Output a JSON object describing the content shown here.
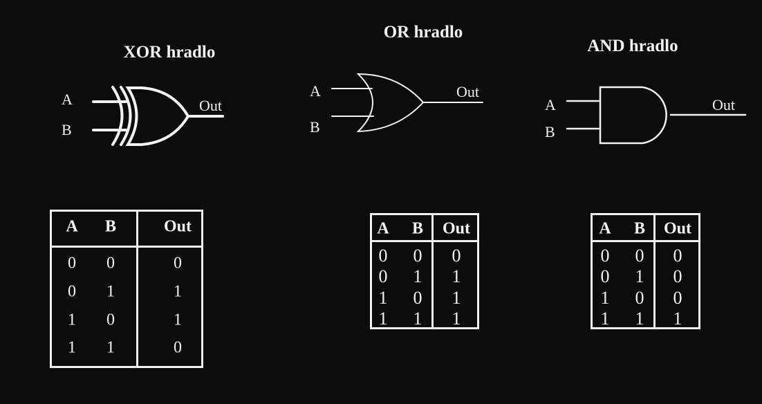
{
  "xor": {
    "title": "XOR hradlo",
    "input_a": "A",
    "input_b": "B",
    "output": "Out",
    "table": {
      "headers": [
        "A",
        "B",
        "Out"
      ],
      "rows": [
        [
          "0",
          "0",
          "0"
        ],
        [
          "0",
          "1",
          "1"
        ],
        [
          "1",
          "0",
          "1"
        ],
        [
          "1",
          "1",
          "0"
        ]
      ]
    }
  },
  "or": {
    "title": "OR hradlo",
    "input_a": "A",
    "input_b": "B",
    "output": "Out",
    "table": {
      "headers": [
        "A",
        "B",
        "Out"
      ],
      "rows": [
        [
          "0",
          "0",
          "0"
        ],
        [
          "0",
          "1",
          "1"
        ],
        [
          "1",
          "0",
          "1"
        ],
        [
          "1",
          "1",
          "1"
        ]
      ]
    }
  },
  "and": {
    "title": "AND hradlo",
    "input_a": "A",
    "input_b": "B",
    "output": "Out",
    "table": {
      "headers": [
        "A",
        "B",
        "Out"
      ],
      "rows": [
        [
          "0",
          "0",
          "0"
        ],
        [
          "0",
          "1",
          "0"
        ],
        [
          "1",
          "0",
          "0"
        ],
        [
          "1",
          "1",
          "1"
        ]
      ]
    }
  }
}
